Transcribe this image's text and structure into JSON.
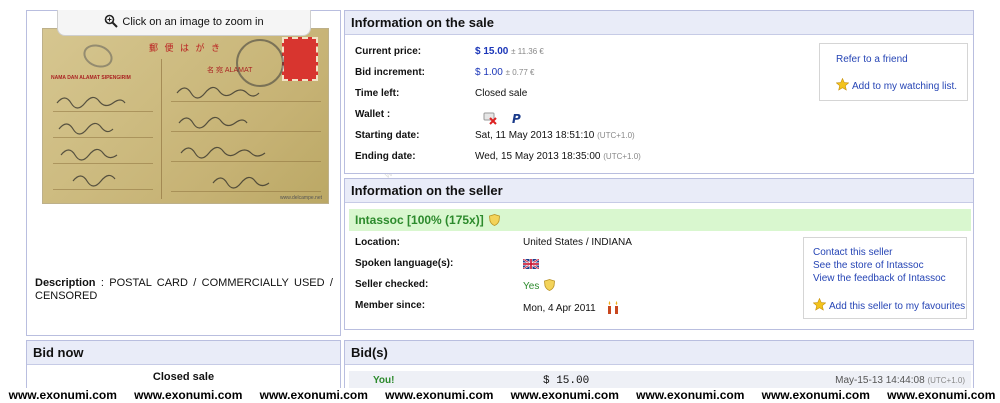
{
  "zoom": {
    "label": "Click on an image to zoom in"
  },
  "description": {
    "label": "Description",
    "text": ": POSTAL CARD / COMMERCIALLY USED / CENSORED"
  },
  "postcard": {
    "jp": "郵 便 は が き",
    "lbl": "NAMA DAN ALAMAT SIPENGIRIM",
    "lbl2": "名 宛 ALAMAT",
    "foot": "www.delcampe.net"
  },
  "sale": {
    "title": "Information on the sale",
    "current_price_label": "Current price:",
    "current_price": "$ 15.00",
    "current_price_alt": "± 11.36 €",
    "bid_increment_label": "Bid increment:",
    "bid_increment": "$ 1.00",
    "bid_increment_alt": "± 0.77 €",
    "time_left_label": "Time left:",
    "time_left": "Closed sale",
    "wallet_label": "Wallet :",
    "starting_label": "Starting date:",
    "starting_value": "Sat, 11 May 2013 18:51:10",
    "starting_tz": "(UTC+1.0)",
    "ending_label": "Ending date:",
    "ending_value": "Wed, 15 May 2013 18:35:00",
    "ending_tz": "(UTC+1.0)",
    "refer_friend": "Refer to a friend",
    "add_watch": "Add to my watching list."
  },
  "seller": {
    "title": "Information on the seller",
    "name": "Intassoc [100% (175x)]",
    "location_label": "Location:",
    "location": "United States / INDIANA",
    "languages_label": "Spoken language(s):",
    "checked_label": "Seller checked:",
    "checked_value": "Yes",
    "since_label": "Member since:",
    "since_value": "Mon, 4 Apr 2011",
    "contact": "Contact this seller",
    "store": "See the store of Intassoc",
    "feedback": "View the feedback of Intassoc",
    "favourites": "Add this seller to my favourites"
  },
  "bidnow": {
    "title": "Bid now",
    "status": "Closed sale"
  },
  "bids": {
    "title": "Bid(s)",
    "rows": [
      {
        "bidder": "You!",
        "amount": "$ 15.00",
        "date": "May-15-13 14:44:08",
        "tz": "(UTC+1.0)"
      }
    ]
  },
  "watermark": [
    "www.exonumi.com",
    "www.exonumi.com",
    "www.exonumi.com",
    "www.exonumi.com",
    "www.exonumi.com",
    "www.exonumi.com",
    "www.exonumi.com",
    "www.exonumi.com"
  ],
  "colors": {
    "panel_border": "#b9bedf",
    "header_bg": "#e9ecf8",
    "link": "#2645b5",
    "seller_band": "#d9f7cf",
    "seller_green": "#2c8a2c"
  }
}
